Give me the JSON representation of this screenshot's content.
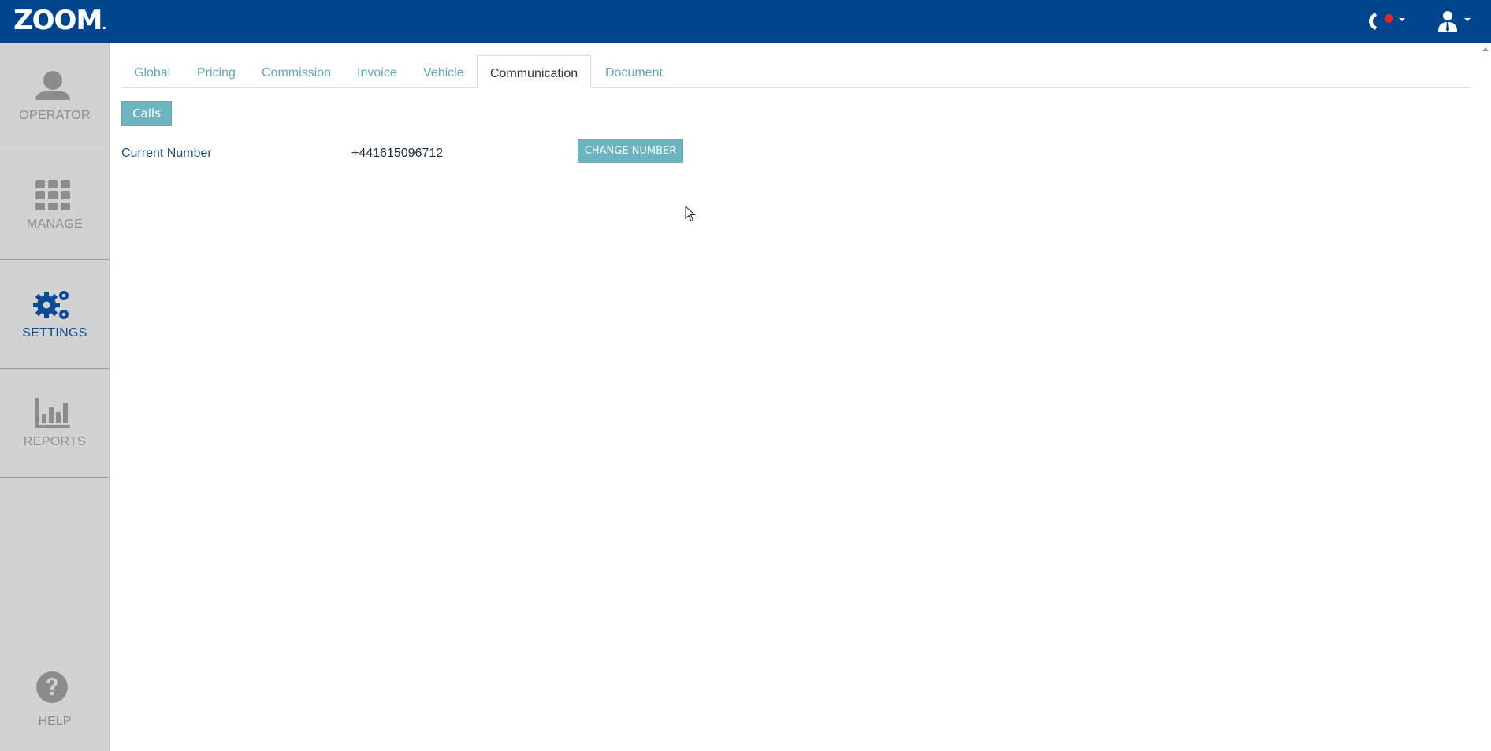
{
  "app": {
    "logo_text": "ZOOM",
    "logo_mark": "."
  },
  "header": {
    "phone_icon": "phone-icon",
    "phone_status_color": "#e3262b",
    "user_icon": "user-icon"
  },
  "sidebar": {
    "items": [
      {
        "label": "OPERATOR",
        "icon": "person-icon"
      },
      {
        "label": "MANAGE",
        "icon": "grid-icon"
      },
      {
        "label": "SETTINGS",
        "icon": "gears-icon",
        "active": true
      },
      {
        "label": "REPORTS",
        "icon": "bar-chart-icon"
      }
    ],
    "help": {
      "label": "HELP",
      "icon": "question-icon"
    }
  },
  "tabs": [
    {
      "label": "Global"
    },
    {
      "label": "Pricing"
    },
    {
      "label": "Commission"
    },
    {
      "label": "Invoice"
    },
    {
      "label": "Vehicle"
    },
    {
      "label": "Communication",
      "active": true
    },
    {
      "label": "Document"
    }
  ],
  "communication": {
    "calls_label": "Calls",
    "current_number_label": "Current Number",
    "current_number_value": "+441615096712",
    "change_number_label": "CHANGE NUMBER"
  },
  "colors": {
    "header": "#00458d",
    "accent": "#6cb4bf",
    "tab_link": "#5ea9b8",
    "active_nav": "#0a4a93"
  }
}
